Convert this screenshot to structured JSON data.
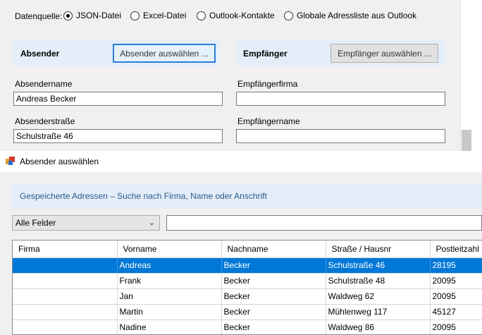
{
  "main": {
    "datasource_label": "Datenquelle:",
    "datasource_options": [
      {
        "label": "JSON-Datei",
        "checked": true
      },
      {
        "label": "Excel-Datei",
        "checked": false
      },
      {
        "label": "Outlook-Kontakte",
        "checked": false
      },
      {
        "label": "Globale Adressliste aus Outlook",
        "checked": false
      }
    ],
    "sender_title": "Absender",
    "sender_button": "Absender auswählen ...",
    "recipient_title": "Empfänger",
    "recipient_button": "Empfänger auswählen ...",
    "sender_name_label": "Absendername",
    "sender_name_value": "Andreas Becker",
    "sender_street_label": "Absenderstraße",
    "sender_street_value": "Schulstraße 46",
    "recipient_company_label": "Empfängerfirma",
    "recipient_company_value": "",
    "recipient_name_label": "Empfängername",
    "recipient_name_value": ""
  },
  "dialog": {
    "title": "Absender auswählen",
    "hint": "Gespeicherte Adressen – Suche nach Firma, Name oder Anschrift",
    "field_select_value": "Alle Felder",
    "search_value": "",
    "columns": [
      "Firma",
      "Vorname",
      "Nachname",
      "Straße / Hausnr",
      "Postleitzahl"
    ],
    "rows": [
      {
        "firma": "",
        "vorname": "Andreas",
        "nachname": "Becker",
        "strasse": "Schulstraße 46",
        "plz": "28195",
        "selected": true
      },
      {
        "firma": "",
        "vorname": "Frank",
        "nachname": "Becker",
        "strasse": "Schulstraße 48",
        "plz": "20095",
        "selected": false
      },
      {
        "firma": "",
        "vorname": "Jan",
        "nachname": "Becker",
        "strasse": "Waldweg 62",
        "plz": "20095",
        "selected": false
      },
      {
        "firma": "",
        "vorname": "Martin",
        "nachname": "Becker",
        "strasse": "Mühlenweg 117",
        "plz": "45127",
        "selected": false
      },
      {
        "firma": "",
        "vorname": "Nadine",
        "nachname": "Becker",
        "strasse": "Waldweg 86",
        "plz": "20095",
        "selected": false
      }
    ],
    "selection_color": "#0078d7"
  }
}
